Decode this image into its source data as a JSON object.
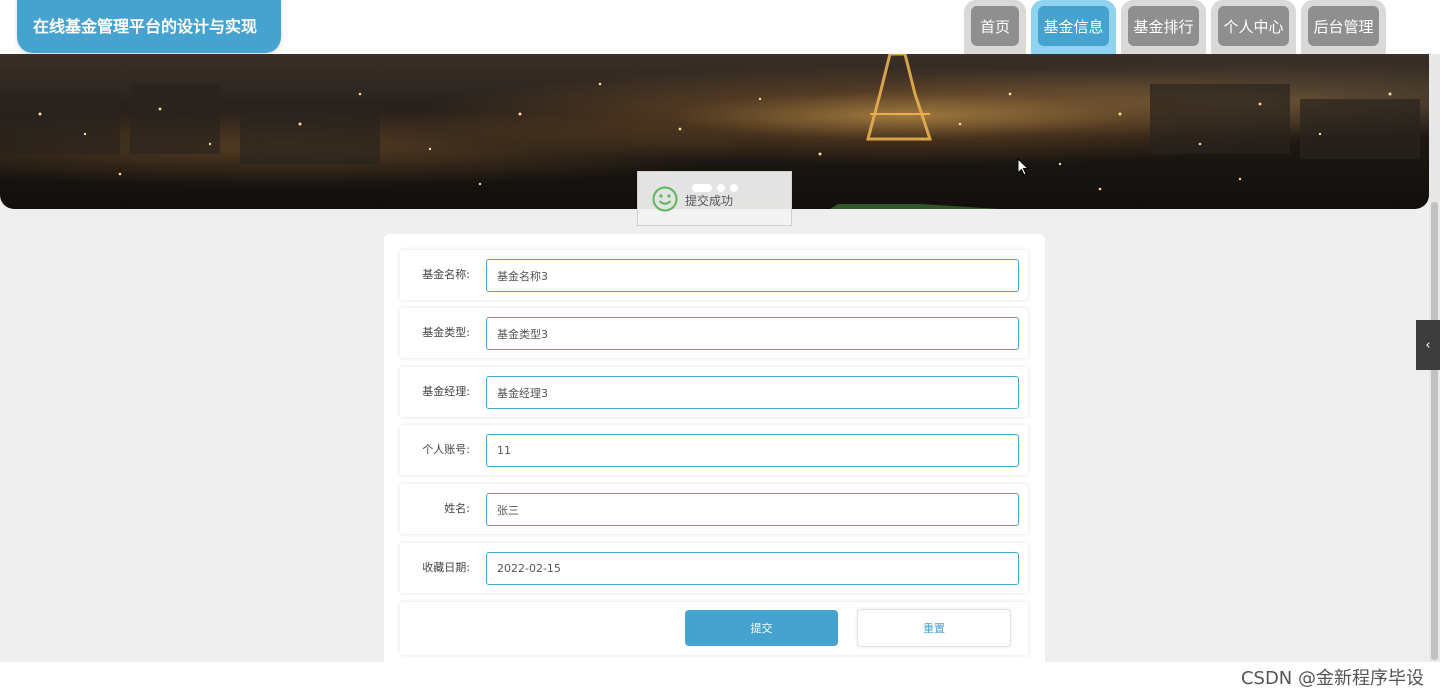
{
  "header": {
    "site_title": "在线基金管理平台的设计与实现",
    "nav": [
      {
        "label": "首页",
        "active": false
      },
      {
        "label": "基金信息",
        "active": true
      },
      {
        "label": "基金排行",
        "active": false
      },
      {
        "label": "个人中心",
        "active": false
      },
      {
        "label": "后台管理",
        "active": false
      }
    ]
  },
  "toast": {
    "message": "提交成功",
    "icon": "smile-icon"
  },
  "side_toggle": {
    "icon": "chevron-left-icon",
    "glyph": "‹"
  },
  "form": {
    "fields": [
      {
        "label": "基金名称:",
        "value": "基金名称3"
      },
      {
        "label": "基金类型:",
        "value": "基金类型3"
      },
      {
        "label": "基金经理:",
        "value": "基金经理3"
      },
      {
        "label": "个人账号:",
        "value": "11"
      },
      {
        "label": "姓名:",
        "value": "张三"
      },
      {
        "label": "收藏日期:",
        "value": "2022-02-15"
      }
    ],
    "submit_label": "提交",
    "reset_label": "重置"
  },
  "watermark": "CSDN @金新程序毕设",
  "colors": {
    "accent": "#46a3cf",
    "nav_inactive": "#8f8f8f",
    "page_bg": "#efefef"
  }
}
